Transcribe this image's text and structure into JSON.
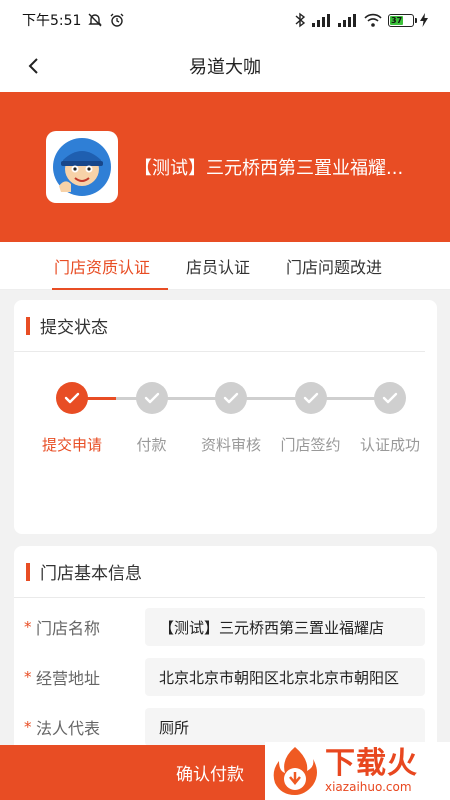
{
  "status": {
    "time": "下午5:51",
    "battery": "37"
  },
  "nav": {
    "title": "易道大咖"
  },
  "store": {
    "name": "【测试】三元桥西第三置业福耀..."
  },
  "tabs": [
    {
      "label": "门店资质认证",
      "active": true
    },
    {
      "label": "店员认证",
      "active": false
    },
    {
      "label": "门店问题改进",
      "active": false
    }
  ],
  "submit_card": {
    "title": "提交状态",
    "steps": [
      {
        "label": "提交申请",
        "done": true
      },
      {
        "label": "付款",
        "done": false
      },
      {
        "label": "资料审核",
        "done": false
      },
      {
        "label": "门店签约",
        "done": false
      },
      {
        "label": "认证成功",
        "done": false
      }
    ]
  },
  "info_card": {
    "title": "门店基本信息",
    "rows": [
      {
        "required": "*",
        "label": "门店名称",
        "value": "【测试】三元桥西第三置业福耀店"
      },
      {
        "required": "*",
        "label": "经营地址",
        "value": "北京北京市朝阳区北京北京市朝阳区"
      },
      {
        "required": "*",
        "label": "法人代表",
        "value": "厕所"
      }
    ]
  },
  "footer": {
    "confirm_label": "确认付款"
  },
  "watermark": {
    "big": "下载火",
    "small": "xiazaihuo.com"
  },
  "colors": {
    "accent": "#e84d24",
    "inactive": "#cfcfcf"
  }
}
